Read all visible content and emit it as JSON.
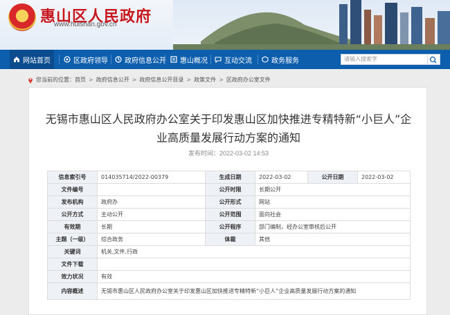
{
  "header": {
    "site_title": "惠山区人民政府",
    "site_url": "www.huishan.gov.cn",
    "emblem_icon": "national-emblem-icon"
  },
  "nav": {
    "items": [
      {
        "label": "网站首页",
        "icon": "home-icon"
      },
      {
        "label": "区政府领导",
        "icon": "leader-icon"
      },
      {
        "label": "政府信息公开",
        "icon": "info-icon"
      },
      {
        "label": "惠山概况",
        "icon": "overview-icon"
      },
      {
        "label": "互动交流",
        "icon": "interaction-icon"
      },
      {
        "label": "政务服务",
        "icon": "service-icon"
      }
    ],
    "search_placeholder": "请输入搜索字",
    "accent": "#0d5fae"
  },
  "breadcrumb": {
    "prefix": "您当前的位置：",
    "items": [
      "首页",
      "政府信息公开",
      "政府信息公开目录",
      "政策文件",
      "区政府办公室文件"
    ]
  },
  "document": {
    "title": "无锡市惠山区人民政府办公室关于印发惠山区加快推进专精特新“小巨人”企业高质量发展行动方案的通知",
    "publish_label": "发布时间：",
    "publish_time": "2022-03-02 14:53"
  },
  "info_table": {
    "index_label": "信息索引号",
    "index_value": "014035714/2022-00379",
    "gen_date_label": "生成日期",
    "gen_date_value": "2022-03-02",
    "pub_date_label": "公开日期",
    "pub_date_value": "2022-03-02",
    "doc_no_label": "文件编号",
    "doc_no_value": "",
    "pub_period_label": "公开时限",
    "pub_period_value": "长期公开",
    "issuer_label": "发布机构",
    "issuer_value": "政府办",
    "pub_form_label": "公开形式",
    "pub_form_value": "网站",
    "pub_method_label": "公开方式",
    "pub_method_value": "主动公开",
    "pub_scope_label": "公开范围",
    "pub_scope_value": "面向社会",
    "validity_label": "有效期",
    "validity_value": "长期",
    "pub_proc_label": "公开程序",
    "pub_proc_value": "部门编制，经办公室审核后公开",
    "topic_label": "主题（一级）",
    "topic_value": "综合政务",
    "genre_label": "体裁",
    "genre_value": "其他",
    "keywords_label": "关键词",
    "keywords_value": "机关,文件,行政",
    "download_label": "文件下载",
    "download_value": "",
    "status_label": "效力状况",
    "status_value": "有效",
    "summary_label": "内容概述",
    "summary_value": "无锡市惠山区人民政府办公室关于印发惠山区加快推进专精特新“小巨人”企业高质量发展行动方案的通知"
  }
}
